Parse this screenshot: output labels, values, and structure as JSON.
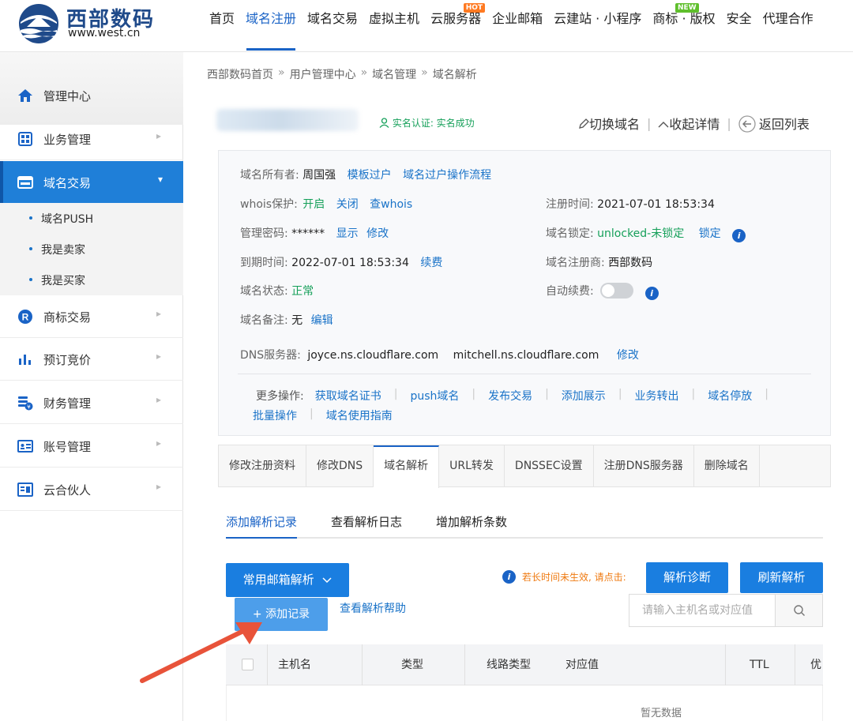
{
  "brand": {
    "name": "西部数码",
    "url": "www.west.cn",
    "colors": {
      "primary": "#1a7ee0",
      "link": "#1a73c8",
      "success": "#16a05a",
      "warning": "#ef7a11",
      "arrow": "#e8533a"
    }
  },
  "nav": {
    "items": [
      {
        "label": "首页"
      },
      {
        "label": "域名注册"
      },
      {
        "label": "域名交易"
      },
      {
        "label": "虚拟主机"
      },
      {
        "label": "云服务器",
        "tag": "HOT"
      },
      {
        "label": "企业邮箱"
      },
      {
        "label": "云建站 · 小程序"
      },
      {
        "label": "商标 · 版权",
        "tag": "NEW"
      },
      {
        "label": "安全"
      },
      {
        "label": "代理合作"
      }
    ]
  },
  "sidebar": {
    "items": [
      {
        "label": "管理中心",
        "icon": "home-icon"
      },
      {
        "label": "业务管理",
        "icon": "grid-icon"
      },
      {
        "label": "域名交易",
        "icon": "www-icon"
      },
      {
        "label": "商标交易",
        "icon": "r-trademark-icon"
      },
      {
        "label": "预订竞价",
        "icon": "bar-chart-icon"
      },
      {
        "label": "财务管理",
        "icon": "coins-icon"
      },
      {
        "label": "账号管理",
        "icon": "id-card-icon"
      },
      {
        "label": "云合伙人",
        "icon": "partner-icon"
      }
    ],
    "subitems": [
      {
        "label": "域名PUSH"
      },
      {
        "label": "我是卖家"
      },
      {
        "label": "我是买家"
      }
    ]
  },
  "breadcrumb": [
    "西部数码首页",
    "用户管理中心",
    "域名管理",
    "域名解析"
  ],
  "domain_header": {
    "verify": "实名认证: 实名成功",
    "switch": "切换域名",
    "collapse": "收起详情",
    "back": "返回列表"
  },
  "info": {
    "owner_k": "域名所有者:",
    "owner_v": "周国强",
    "owner_l1": "模板过户",
    "owner_l2": "域名过户操作流程",
    "whois_k": "whois保护:",
    "whois_l1": "开启",
    "whois_l2": "关闭",
    "whois_l3": "查whois",
    "reg_time_k": "注册时间:",
    "reg_time_v": "2021-07-01 18:53:34",
    "pwd_k": "管理密码:",
    "pwd_v": "******",
    "pwd_l1": "显示",
    "pwd_l2": "修改",
    "lock_k": "域名锁定:",
    "lock_v": "unlocked-未锁定",
    "lock_l": "锁定",
    "expire_k": "到期时间:",
    "expire_v": "2022-07-01 18:53:34",
    "expire_l": "续费",
    "registrar_k": "域名注册商:",
    "registrar_v": "西部数码",
    "status_k": "域名状态:",
    "status_v": "正常",
    "autorenew_k": "自动续费:",
    "note_k": "域名备注:",
    "note_v": "无",
    "note_l": "编辑",
    "dns_k": "DNS服务器:",
    "dns_v1": "joyce.ns.cloudflare.com",
    "dns_v2": "mitchell.ns.cloudflare.com",
    "dns_l": "修改",
    "more_k": "更多操作:",
    "more_links": [
      "获取域名证书",
      "push域名",
      "发布交易",
      "添加展示",
      "业务转出",
      "域名停放",
      "批量操作",
      "域名使用指南"
    ]
  },
  "tabs": [
    "修改注册资料",
    "修改DNS",
    "域名解析",
    "URL转发",
    "DNSSEC设置",
    "注册DNS服务器",
    "删除域名"
  ],
  "subtabs": [
    "添加解析记录",
    "查看解析日志",
    "增加解析条数"
  ],
  "toolbar": {
    "mail_btn": "常用邮箱解析",
    "add_btn": "+ 添加记录",
    "help": "查看解析帮助",
    "notice": "若长时间未生效, 请点击:",
    "diag_btn": "解析诊断",
    "refresh_btn": "刷新解析",
    "search_placeholder": "请输入主机名或对应值"
  },
  "table": {
    "columns": [
      "主机名",
      "类型",
      "线路类型",
      "对应值",
      "TTL",
      "优"
    ],
    "empty": "暂无数据"
  }
}
